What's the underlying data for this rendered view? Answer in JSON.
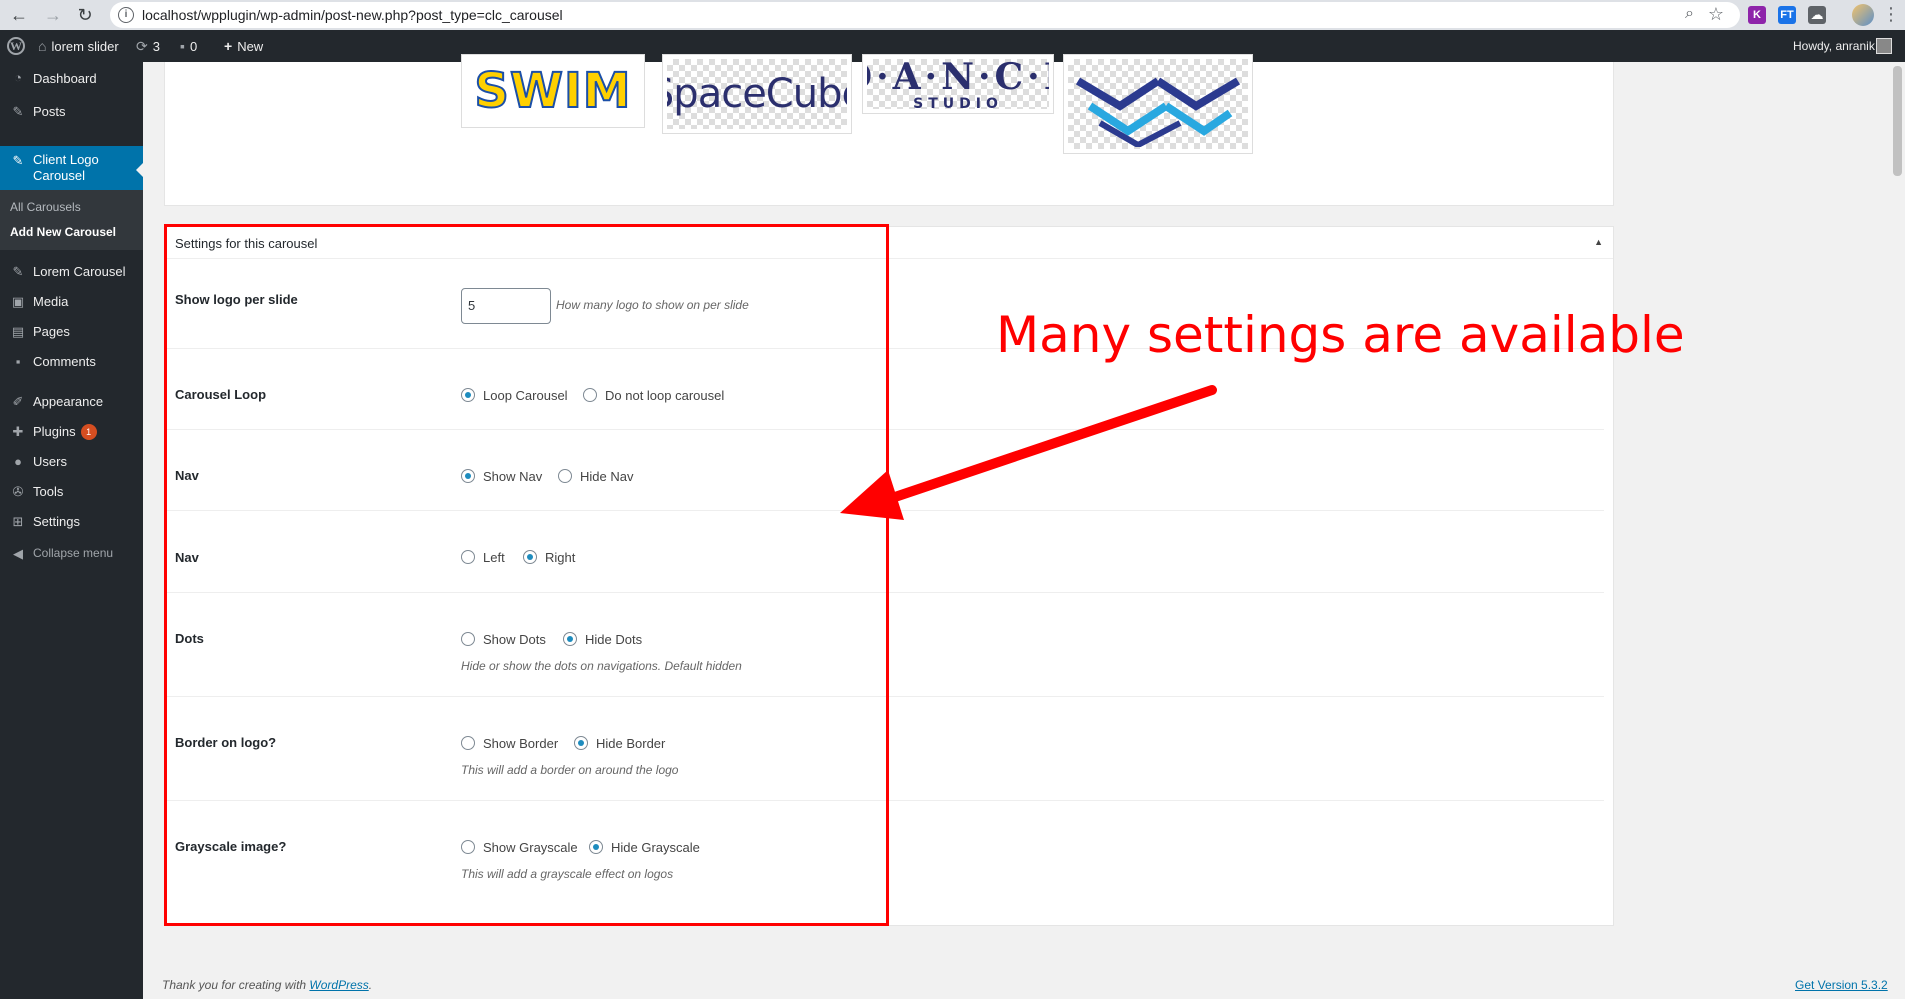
{
  "browser": {
    "url": "localhost/wpplugin/wp-admin/post-new.php?post_type=clc_carousel",
    "extensions": [
      {
        "name": "K",
        "color": "#c0392b"
      },
      {
        "name": "FT",
        "color": "#1a73e8"
      }
    ]
  },
  "admin_bar": {
    "site_name": "lorem slider",
    "updates_count": "3",
    "comments_count": "0",
    "new_label": "New",
    "howdy": "Howdy, anranik"
  },
  "sidebar": {
    "dashboard": "Dashboard",
    "posts": "Posts",
    "client_logo_carousel": "Client Logo Carousel",
    "all_carousels": "All Carousels",
    "add_new_carousel": "Add New Carousel",
    "lorem_carousel": "Lorem Carousel",
    "media": "Media",
    "pages": "Pages",
    "comments": "Comments",
    "appearance": "Appearance",
    "plugins": "Plugins",
    "plugins_badge": "1",
    "users": "Users",
    "tools": "Tools",
    "settings": "Settings",
    "collapse": "Collapse menu"
  },
  "logos": {
    "swim": "SWIM",
    "spacecube": "SpaceCube",
    "dance_main": "D·A·N·C·E",
    "dance_sub": "STUDIO"
  },
  "settings_panel": {
    "title": "Settings for this carousel",
    "rows": [
      {
        "label": "Show logo per slide",
        "input_value": "5",
        "hint": "How many logo to show on per slide"
      },
      {
        "label": "Carousel Loop",
        "options": [
          "Loop Carousel",
          "Do not loop carousel"
        ],
        "selected": 0
      },
      {
        "label": "Nav",
        "options": [
          "Show Nav",
          "Hide Nav"
        ],
        "selected": 0
      },
      {
        "label": "Nav",
        "options": [
          "Left",
          "Right"
        ],
        "selected": 1
      },
      {
        "label": "Dots",
        "options": [
          "Show Dots",
          "Hide Dots"
        ],
        "selected": 1,
        "hint": "Hide or show the dots on navigations. Default hidden"
      },
      {
        "label": "Border on logo?",
        "options": [
          "Show Border",
          "Hide Border"
        ],
        "selected": 1,
        "hint": "This will add a border on around the logo"
      },
      {
        "label": "Grayscale image?",
        "options": [
          "Show Grayscale",
          "Hide Grayscale"
        ],
        "selected": 1,
        "hint": "This will add a grayscale effect on logos"
      }
    ]
  },
  "annotation": {
    "text": "Many settings are available",
    "color": "#ff0000"
  },
  "footer": {
    "thanks_prefix": "Thank you for creating with ",
    "thanks_link": "WordPress",
    "thanks_suffix": ".",
    "version": "Get Version 5.3.2"
  },
  "colors": {
    "admin_bar": "#23282d",
    "menu_active": "#0073aa",
    "radio_checked": "#1e8cbe"
  }
}
